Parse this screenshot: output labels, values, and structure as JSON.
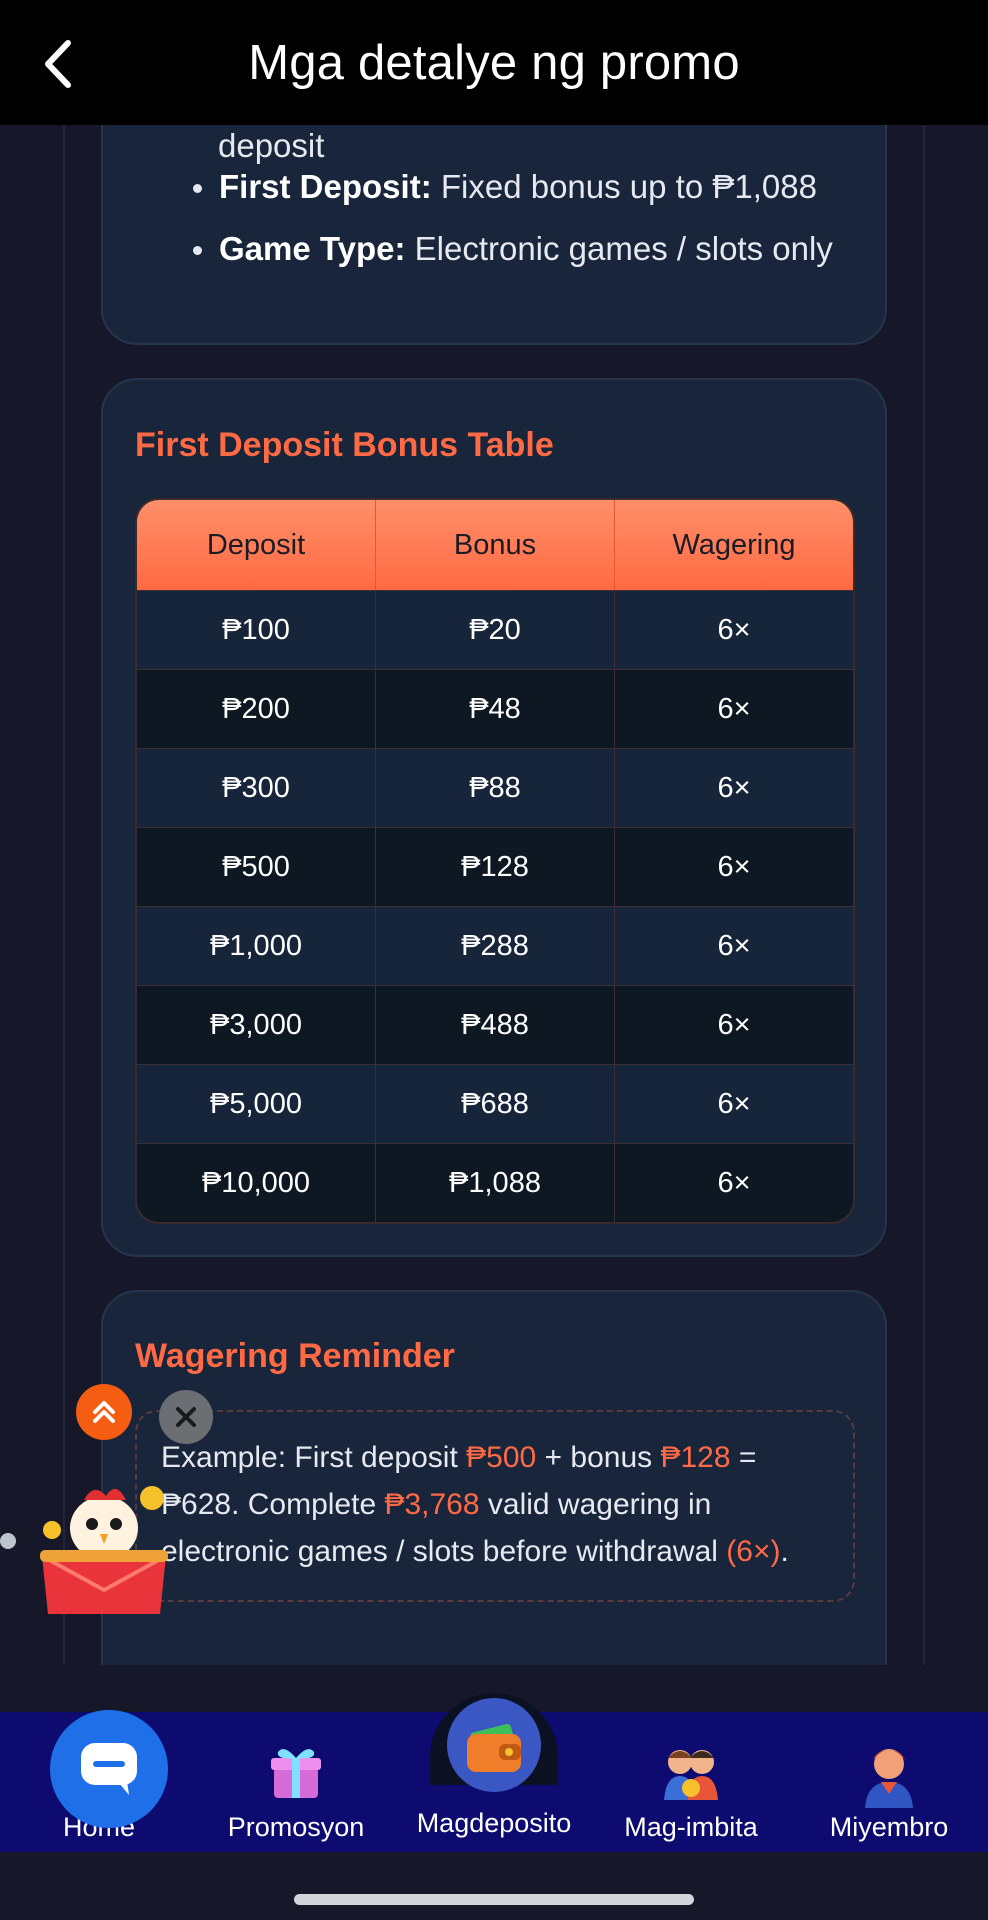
{
  "header": {
    "title": "Mga detalye ng promo"
  },
  "rules_card": {
    "partial_line": "deposit",
    "items": [
      {
        "label": "First Deposit:",
        "text": "Fixed bonus up to ₱1,088"
      },
      {
        "label": "Game Type:",
        "text": "Electronic games / slots only"
      }
    ]
  },
  "bonus_table": {
    "title": "First Deposit Bonus Table",
    "headers": [
      "Deposit",
      "Bonus",
      "Wagering"
    ],
    "rows": [
      [
        "₱100",
        "₱20",
        "6×"
      ],
      [
        "₱200",
        "₱48",
        "6×"
      ],
      [
        "₱300",
        "₱88",
        "6×"
      ],
      [
        "₱500",
        "₱128",
        "6×"
      ],
      [
        "₱1,000",
        "₱288",
        "6×"
      ],
      [
        "₱3,000",
        "₱488",
        "6×"
      ],
      [
        "₱5,000",
        "₱688",
        "6×"
      ],
      [
        "₱10,000",
        "₱1,088",
        "6×"
      ]
    ]
  },
  "reminder": {
    "title": "Wagering Reminder",
    "t1": "Example: First deposit ",
    "h1": "₱500",
    "t2": " + bonus ",
    "h2": "₱128",
    "t3": " = ₱628. Complete ",
    "h3": "₱3,768",
    "t4": " valid wagering in electronic games / slots before withdrawal ",
    "h4": "(6×)",
    "t5": "."
  },
  "nav": {
    "items": [
      {
        "label": "Home",
        "icon": "chat-icon"
      },
      {
        "label": "Promosyon",
        "icon": "gift-icon"
      },
      {
        "label": "Magdeposito",
        "icon": "wallet-icon"
      },
      {
        "label": "Mag-imbita",
        "icon": "friends-icon"
      },
      {
        "label": "Miyembro",
        "icon": "member-icon"
      }
    ]
  },
  "colors": {
    "accent": "#ff6a45",
    "header_bg": "#000000",
    "card_bg": "#18253a",
    "nav_bg": "#0d0b6f",
    "chat_button": "#1e6fe8"
  }
}
